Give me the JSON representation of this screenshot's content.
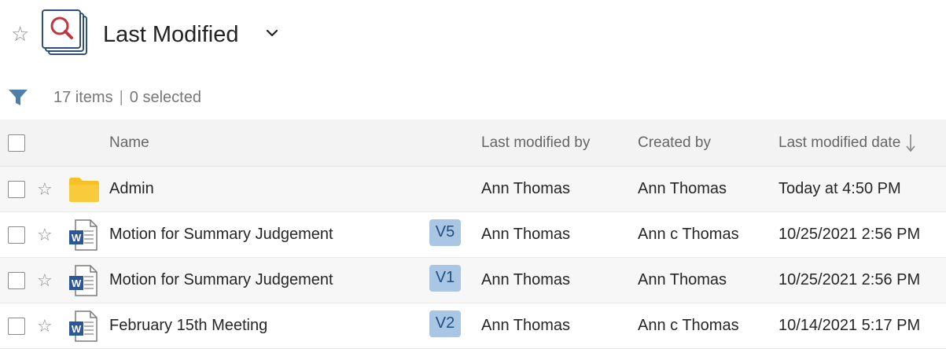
{
  "header": {
    "view_title": "Last Modified"
  },
  "toolbar": {
    "item_count": "17 items",
    "separator": "|",
    "selected_count": "0 selected"
  },
  "columns": {
    "name": "Name",
    "modified_by": "Last modified by",
    "created_by": "Created by",
    "modified_date": "Last modified date"
  },
  "rows": [
    {
      "type": "folder",
      "name": "Admin",
      "version": "",
      "modified_by": "Ann Thomas",
      "created_by": "Ann Thomas",
      "modified_date": "Today at 4:50 PM"
    },
    {
      "type": "word",
      "name": "Motion for Summary Judgement",
      "version": "V5",
      "modified_by": "Ann Thomas",
      "created_by": "Ann c Thomas",
      "modified_date": "10/25/2021 2:56 PM"
    },
    {
      "type": "word",
      "name": "Motion for Summary Judgement",
      "version": "V1",
      "modified_by": "Ann Thomas",
      "created_by": "Ann Thomas",
      "modified_date": "10/25/2021 2:56 PM"
    },
    {
      "type": "word",
      "name": "February 15th Meeting",
      "version": "V2",
      "modified_by": "Ann Thomas",
      "created_by": "Ann c Thomas",
      "modified_date": "10/14/2021 5:17 PM"
    }
  ],
  "icons": {
    "favorite": "star-outline-icon",
    "view": "search-documents-icon",
    "filter": "filter-icon",
    "folder": "folder-icon",
    "word": "word-document-icon",
    "sort": "sort-descending-icon"
  },
  "colors": {
    "folder": "#f6c026",
    "word_blue": "#2b579a",
    "version_badge": "#a9c6e5",
    "filter": "#4f7fa6",
    "view_icon_red": "#c0343c"
  }
}
